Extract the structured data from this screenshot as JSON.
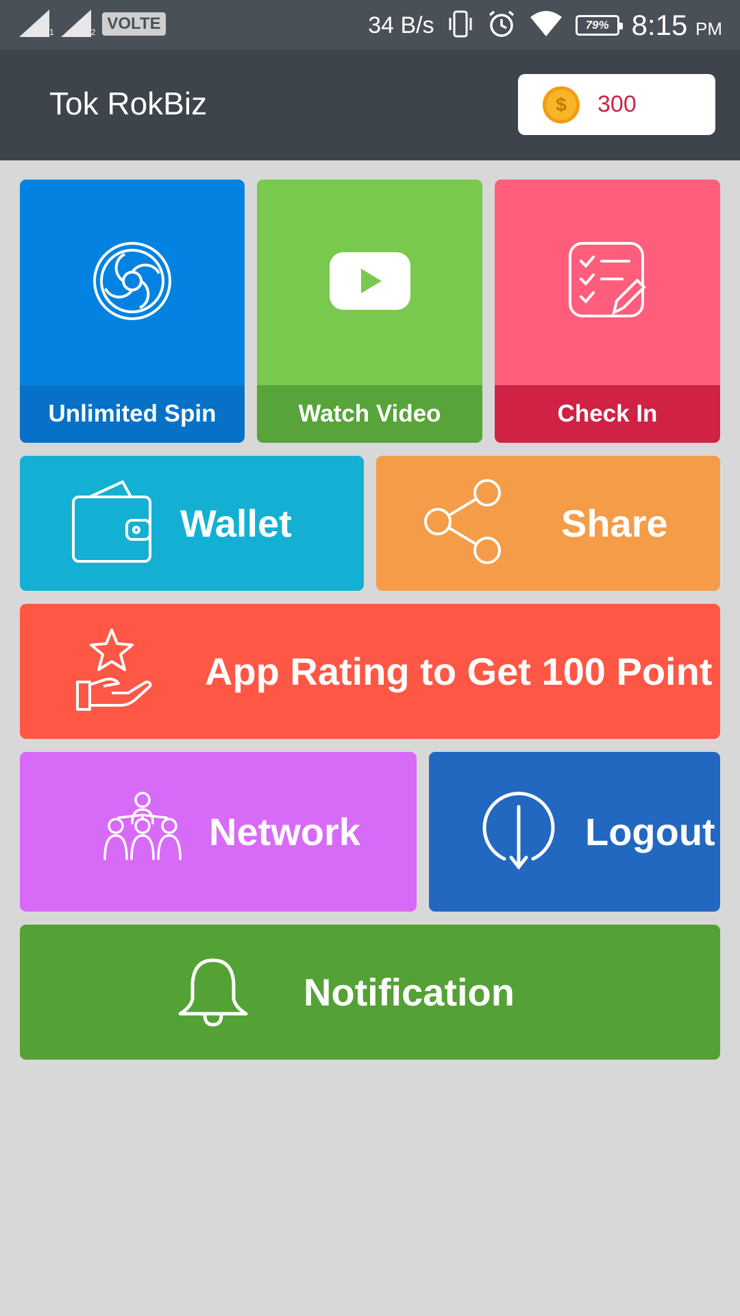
{
  "status_bar": {
    "sim1": "1",
    "sim2": "2",
    "network_tag": "VOLTE",
    "speed": "34 B/s",
    "battery": "79%",
    "time": "8:15",
    "ampm": "PM"
  },
  "header": {
    "title": "Tok RokBiz",
    "coin_symbol": "$",
    "coin_count": "300"
  },
  "tiles": {
    "spin": {
      "label": "Unlimited Spin",
      "icon": "spin-wheel-icon",
      "color": "#0482e1",
      "bar_color": "#0671c6"
    },
    "video": {
      "label": "Watch Video",
      "icon": "play-video-icon",
      "color": "#79c94f",
      "bar_color": "#58a43a"
    },
    "checkin": {
      "label": "Check In",
      "icon": "checklist-icon",
      "color": "#fe5e7c",
      "bar_color": "#cf2244"
    },
    "wallet": {
      "label": "Wallet",
      "icon": "wallet-icon",
      "color": "#13b0d3"
    },
    "share": {
      "label": "Share",
      "icon": "share-icon",
      "color": "#f59c49"
    },
    "rating": {
      "label": "App Rating to Get 100 Point",
      "icon": "star-hand-icon",
      "color": "#fe5745"
    },
    "network": {
      "label": "Network",
      "icon": "network-icon",
      "color": "#d86af8"
    },
    "logout": {
      "label": "Logout",
      "icon": "logout-icon",
      "color": "#2368c0"
    },
    "notification": {
      "label": "Notification",
      "icon": "bell-icon",
      "color": "#54a136"
    }
  }
}
